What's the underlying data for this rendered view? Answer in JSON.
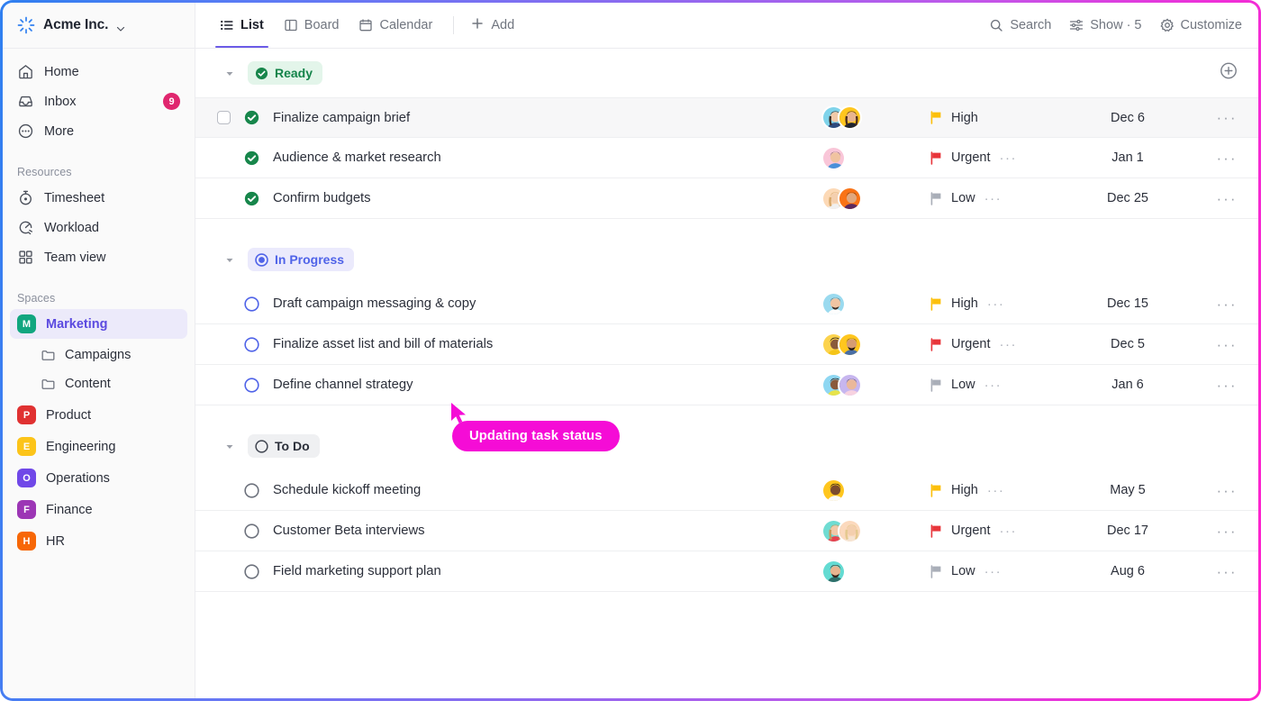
{
  "window": {
    "border_gradient_from": "#2f7ff0",
    "border_gradient_to": "#ff22cc"
  },
  "sidebar": {
    "brand": {
      "name": "Acme Inc.",
      "logo_icon": "spark-logo-icon",
      "chevron_icon": "chevron-down-icon"
    },
    "nav": [
      {
        "label": "Home",
        "icon": "home-icon",
        "badge": ""
      },
      {
        "label": "Inbox",
        "icon": "inbox-icon",
        "badge": "9"
      },
      {
        "label": "More",
        "icon": "ellipsis-circle-icon",
        "badge": ""
      }
    ],
    "resources_label": "Resources",
    "resources": [
      {
        "label": "Timesheet",
        "icon": "stopwatch-icon"
      },
      {
        "label": "Workload",
        "icon": "gauge-icon"
      },
      {
        "label": "Team view",
        "icon": "grid-squares-icon"
      }
    ],
    "spaces_label": "Spaces",
    "spaces": [
      {
        "label": "Marketing",
        "initial": "M",
        "color": "#11a67f",
        "selected": true,
        "children": [
          {
            "label": "Campaigns",
            "icon": "folder-icon"
          },
          {
            "label": "Content",
            "icon": "folder-icon"
          }
        ]
      },
      {
        "label": "Product",
        "initial": "P",
        "color": "#e03131",
        "selected": false,
        "children": []
      },
      {
        "label": "Engineering",
        "initial": "E",
        "color": "#fcc419",
        "selected": false,
        "children": []
      },
      {
        "label": "Operations",
        "initial": "O",
        "color": "#7048e8",
        "selected": false,
        "children": []
      },
      {
        "label": "Finance",
        "initial": "F",
        "color": "#9c36b5",
        "selected": false,
        "children": []
      },
      {
        "label": "HR",
        "initial": "H",
        "color": "#f76707",
        "selected": false,
        "children": []
      }
    ]
  },
  "toolbar": {
    "tabs": [
      {
        "label": "List",
        "icon": "list-icon",
        "active": true
      },
      {
        "label": "Board",
        "icon": "board-icon",
        "active": false
      },
      {
        "label": "Calendar",
        "icon": "calendar-icon",
        "active": false
      }
    ],
    "add_label": "Add",
    "add_icon": "plus-icon",
    "search_label": "Search",
    "search_icon": "search-icon",
    "show_label": "Show · 5",
    "show_icon": "sliders-icon",
    "customize_label": "Customize",
    "customize_icon": "gear-icon"
  },
  "list": {
    "add_task_icon": "plus-circle-icon",
    "caret_icon": "caret-down-icon",
    "groups": [
      {
        "status": "Ready",
        "chip_class": "chip-ready",
        "status_icon": "check-circle-filled-icon",
        "show_add": true,
        "tasks": [
          {
            "title": "Finalize campaign brief",
            "status_icon": "check-circle-filled-icon",
            "hovered": true,
            "checkbox": true,
            "avatars": [
              {
                "bg": "#7fd3ea",
                "skin": "#f2c9a8",
                "hair": "#3a2a22",
                "shirt": "#2e4a7d"
              },
              {
                "bg": "#ffc61e",
                "skin": "#e8b48f",
                "hair": "#4a2d1f",
                "shirt": "#1f2430"
              }
            ],
            "priority": "High",
            "priority_color": "#fcbf0a",
            "priority_dots": false,
            "date": "Dec 6",
            "menu_icon": "ellipsis-icon"
          },
          {
            "title": "Audience & market research",
            "status_icon": "check-circle-filled-icon",
            "hovered": false,
            "checkbox": false,
            "avatars": [
              {
                "bg": "#f9c6d8",
                "skin": "#f0c3a0",
                "hair": "#4b3426",
                "shirt": "#4a90d9"
              }
            ],
            "priority": "Urgent",
            "priority_color": "#e8353a",
            "priority_dots": true,
            "date": "Jan 1",
            "menu_icon": "ellipsis-icon"
          },
          {
            "title": "Confirm budgets",
            "status_icon": "check-circle-filled-icon",
            "hovered": false,
            "checkbox": false,
            "avatars": [
              {
                "bg": "#fcd9b6",
                "skin": "#f4cfae",
                "hair": "#d8a86a",
                "shirt": "#f0f0f0"
              },
              {
                "bg": "#f97316",
                "skin": "#e0a77e",
                "hair": "#2b1d15",
                "shirt": "#5b2a5e"
              }
            ],
            "priority": "Low",
            "priority_color": "#a9aeb8",
            "priority_dots": true,
            "date": "Dec 25",
            "menu_icon": "ellipsis-icon"
          }
        ]
      },
      {
        "status": "In Progress",
        "chip_class": "chip-progress",
        "status_icon": "radio-filled-icon",
        "show_add": false,
        "tasks": [
          {
            "title": "Draft campaign messaging & copy",
            "status_icon": "circle-outline-blue-icon",
            "hovered": false,
            "checkbox": false,
            "avatars": [
              {
                "bg": "#9adaef",
                "skin": "#f0c4a2",
                "hair": "#3c2a20",
                "shirt": "#fdfdfd"
              }
            ],
            "priority": "High",
            "priority_color": "#fcbf0a",
            "priority_dots": true,
            "date": "Dec 15",
            "menu_icon": "ellipsis-icon"
          },
          {
            "title": "Finalize asset list and bill of materials",
            "status_icon": "circle-outline-blue-icon",
            "hovered": false,
            "checkbox": false,
            "avatars": [
              {
                "bg": "#fcd34d",
                "skin": "#8a5a3c",
                "hair": "#241611",
                "shirt": "#f5c518"
              },
              {
                "bg": "#ffc61e",
                "skin": "#d69c72",
                "hair": "#2a1a12",
                "shirt": "#4a6fa5"
              }
            ],
            "priority": "Urgent",
            "priority_color": "#e8353a",
            "priority_dots": true,
            "date": "Dec 5",
            "menu_icon": "ellipsis-icon"
          },
          {
            "title": "Define channel strategy",
            "status_icon": "circle-outline-blue-icon",
            "hovered": false,
            "checkbox": false,
            "avatars": [
              {
                "bg": "#8ed7f2",
                "skin": "#8a5a3c",
                "hair": "#221510",
                "shirt": "#e7e34a"
              },
              {
                "bg": "#c7b6ef",
                "skin": "#eab89a",
                "hair": "#2c1c14",
                "shirt": "#f7d2e0"
              }
            ],
            "priority": "Low",
            "priority_color": "#a9aeb8",
            "priority_dots": true,
            "date": "Jan 6",
            "menu_icon": "ellipsis-icon"
          }
        ]
      },
      {
        "status": "To Do",
        "chip_class": "chip-todo",
        "status_icon": "circle-outline-icon",
        "show_add": false,
        "tasks": [
          {
            "title": "Schedule kickoff meeting",
            "status_icon": "circle-outline-icon",
            "hovered": false,
            "checkbox": false,
            "avatars": [
              {
                "bg": "#ffc61e",
                "skin": "#7a4b2e",
                "hair": "#1d1310",
                "shirt": "#fafafa"
              }
            ],
            "priority": "High",
            "priority_color": "#fcbf0a",
            "priority_dots": true,
            "date": "May 5",
            "menu_icon": "ellipsis-icon"
          },
          {
            "title": "Customer Beta interviews",
            "status_icon": "circle-outline-icon",
            "hovered": false,
            "checkbox": false,
            "avatars": [
              {
                "bg": "#6fdcd2",
                "skin": "#f2c9a8",
                "hair": "#c69a5e",
                "shirt": "#e8434f"
              },
              {
                "bg": "#fbd9bd",
                "skin": "#f4cfae",
                "hair": "#e4c98f",
                "shirt": "#f6e4d2"
              }
            ],
            "priority": "Urgent",
            "priority_color": "#e8353a",
            "priority_dots": true,
            "date": "Dec 17",
            "menu_icon": "ellipsis-icon"
          },
          {
            "title": "Field marketing support plan",
            "status_icon": "circle-outline-icon",
            "hovered": false,
            "checkbox": false,
            "avatars": [
              {
                "bg": "#63dbd2",
                "skin": "#e8b48f",
                "hair": "#3a2118",
                "shirt": "#2f6f6a"
              }
            ],
            "priority": "Low",
            "priority_color": "#a9aeb8",
            "priority_dots": true,
            "date": "Aug 6",
            "menu_icon": "ellipsis-icon"
          }
        ]
      }
    ]
  },
  "overlay": {
    "tooltip_text": "Updating task status",
    "tooltip_bg": "#f50cd6",
    "cursor_icon": "cursor-pointer-icon",
    "cursor_color": "#f50cd6"
  }
}
